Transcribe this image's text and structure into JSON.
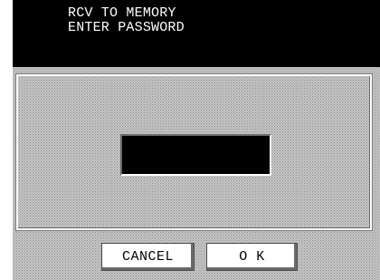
{
  "header": {
    "line1": "RCV TO MEMORY",
    "line2": "ENTER PASSWORD"
  },
  "password_field": {
    "value": ""
  },
  "buttons": {
    "cancel_label": "CANCEL",
    "ok_label": "O K"
  },
  "colors": {
    "header_bg": "#000000",
    "header_text": "#ffffff",
    "screen_bg": "#c8c8c8",
    "field_bg": "#000000",
    "button_bg": "#ffffff"
  }
}
